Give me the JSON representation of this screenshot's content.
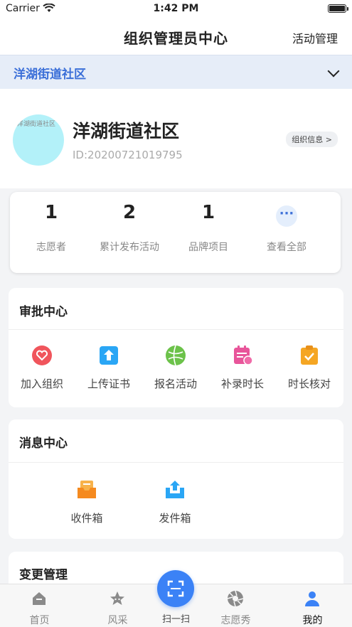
{
  "status_bar": {
    "carrier": "Carrier",
    "time": "1:42 PM"
  },
  "header": {
    "title": "组织管理员中心",
    "right_action": "活动管理"
  },
  "community_selector": {
    "name": "洋湖街道社区"
  },
  "profile": {
    "avatar_text": "洋湖街道社区",
    "name": "洋湖街道社区",
    "id": "ID:20200721019795",
    "info_button": "组织信息 >"
  },
  "stats": [
    {
      "value": "1",
      "label": "志愿者"
    },
    {
      "value": "2",
      "label": "累计发布活动"
    },
    {
      "value": "1",
      "label": "品牌项目"
    },
    {
      "icon": "more-dots-icon",
      "label": "查看全部"
    }
  ],
  "approval": {
    "title": "审批中心",
    "items": [
      {
        "label": "加入组织",
        "icon": "heart-badge-icon",
        "color": "#f0555c"
      },
      {
        "label": "上传证书",
        "icon": "upload-icon",
        "color": "#2aa6f5"
      },
      {
        "label": "报名活动",
        "icon": "ball-icon",
        "color": "#6cc24a"
      },
      {
        "label": "补录时长",
        "icon": "calendar-icon",
        "color": "#e8559a"
      },
      {
        "label": "时长核对",
        "icon": "clipboard-check-icon",
        "color": "#f5a623"
      }
    ]
  },
  "messages": {
    "title": "消息中心",
    "items": [
      {
        "label": "收件箱",
        "icon": "inbox-icon",
        "color": "#f58a1f"
      },
      {
        "label": "发件箱",
        "icon": "outbox-icon",
        "color": "#2aa6f5"
      }
    ]
  },
  "changes": {
    "title": "变更管理"
  },
  "tabbar": {
    "items": [
      {
        "label": "首页",
        "icon": "home-icon"
      },
      {
        "label": "风采",
        "icon": "star-icon"
      },
      {
        "label": "扫一扫",
        "icon": "scan-icon"
      },
      {
        "label": "志愿秀",
        "icon": "aperture-icon"
      },
      {
        "label": "我的",
        "icon": "user-icon"
      }
    ]
  },
  "colors": {
    "accent": "#3b6fd8",
    "scan_button": "#3b82f6",
    "avatar_bg": "#b3f1f9",
    "selector_bg": "#e6edf8"
  }
}
